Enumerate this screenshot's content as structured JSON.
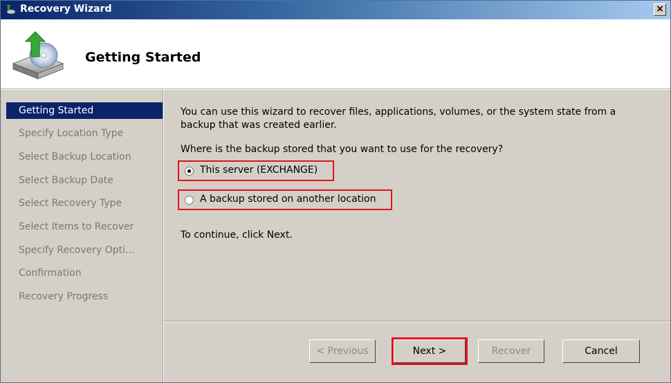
{
  "window": {
    "title": "Recovery Wizard",
    "close_glyph": "×"
  },
  "header": {
    "title": "Getting Started"
  },
  "sidebar": {
    "items": [
      {
        "label": "Getting Started"
      },
      {
        "label": "Specify Location Type"
      },
      {
        "label": "Select Backup Location"
      },
      {
        "label": "Select Backup Date"
      },
      {
        "label": "Select Recovery Type"
      },
      {
        "label": "Select Items to Recover"
      },
      {
        "label": "Specify Recovery Opti..."
      },
      {
        "label": "Confirmation"
      },
      {
        "label": "Recovery Progress"
      }
    ]
  },
  "content": {
    "intro_line1": "You can use this wizard to recover files, applications, volumes, or the system state from a",
    "intro_line2": "backup that was created earlier.",
    "question": "Where is the backup stored that you want to use for the recovery?",
    "options": [
      {
        "label": "This server (EXCHANGE)",
        "selected": true
      },
      {
        "label": "A backup stored on another location",
        "selected": false
      }
    ],
    "continue_text": "To continue, click Next."
  },
  "buttons": {
    "previous": "< Previous",
    "next": "Next >",
    "recover": "Recover",
    "cancel": "Cancel"
  },
  "colors": {
    "highlight": "#e0141e",
    "selection": "#0a246a"
  }
}
